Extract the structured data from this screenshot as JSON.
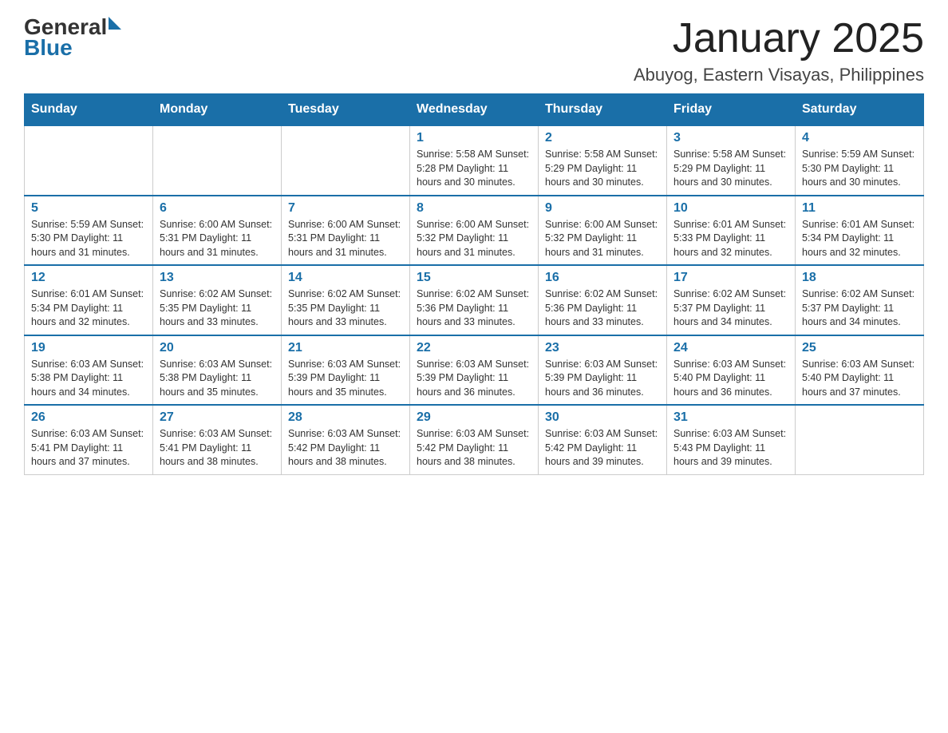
{
  "logo": {
    "text_general": "General",
    "triangle": "▶",
    "text_blue": "Blue"
  },
  "header": {
    "title": "January 2025",
    "subtitle": "Abuyog, Eastern Visayas, Philippines"
  },
  "days_of_week": [
    "Sunday",
    "Monday",
    "Tuesday",
    "Wednesday",
    "Thursday",
    "Friday",
    "Saturday"
  ],
  "weeks": [
    [
      {
        "day": "",
        "info": ""
      },
      {
        "day": "",
        "info": ""
      },
      {
        "day": "",
        "info": ""
      },
      {
        "day": "1",
        "info": "Sunrise: 5:58 AM\nSunset: 5:28 PM\nDaylight: 11 hours and 30 minutes."
      },
      {
        "day": "2",
        "info": "Sunrise: 5:58 AM\nSunset: 5:29 PM\nDaylight: 11 hours and 30 minutes."
      },
      {
        "day": "3",
        "info": "Sunrise: 5:58 AM\nSunset: 5:29 PM\nDaylight: 11 hours and 30 minutes."
      },
      {
        "day": "4",
        "info": "Sunrise: 5:59 AM\nSunset: 5:30 PM\nDaylight: 11 hours and 30 minutes."
      }
    ],
    [
      {
        "day": "5",
        "info": "Sunrise: 5:59 AM\nSunset: 5:30 PM\nDaylight: 11 hours and 31 minutes."
      },
      {
        "day": "6",
        "info": "Sunrise: 6:00 AM\nSunset: 5:31 PM\nDaylight: 11 hours and 31 minutes."
      },
      {
        "day": "7",
        "info": "Sunrise: 6:00 AM\nSunset: 5:31 PM\nDaylight: 11 hours and 31 minutes."
      },
      {
        "day": "8",
        "info": "Sunrise: 6:00 AM\nSunset: 5:32 PM\nDaylight: 11 hours and 31 minutes."
      },
      {
        "day": "9",
        "info": "Sunrise: 6:00 AM\nSunset: 5:32 PM\nDaylight: 11 hours and 31 minutes."
      },
      {
        "day": "10",
        "info": "Sunrise: 6:01 AM\nSunset: 5:33 PM\nDaylight: 11 hours and 32 minutes."
      },
      {
        "day": "11",
        "info": "Sunrise: 6:01 AM\nSunset: 5:34 PM\nDaylight: 11 hours and 32 minutes."
      }
    ],
    [
      {
        "day": "12",
        "info": "Sunrise: 6:01 AM\nSunset: 5:34 PM\nDaylight: 11 hours and 32 minutes."
      },
      {
        "day": "13",
        "info": "Sunrise: 6:02 AM\nSunset: 5:35 PM\nDaylight: 11 hours and 33 minutes."
      },
      {
        "day": "14",
        "info": "Sunrise: 6:02 AM\nSunset: 5:35 PM\nDaylight: 11 hours and 33 minutes."
      },
      {
        "day": "15",
        "info": "Sunrise: 6:02 AM\nSunset: 5:36 PM\nDaylight: 11 hours and 33 minutes."
      },
      {
        "day": "16",
        "info": "Sunrise: 6:02 AM\nSunset: 5:36 PM\nDaylight: 11 hours and 33 minutes."
      },
      {
        "day": "17",
        "info": "Sunrise: 6:02 AM\nSunset: 5:37 PM\nDaylight: 11 hours and 34 minutes."
      },
      {
        "day": "18",
        "info": "Sunrise: 6:02 AM\nSunset: 5:37 PM\nDaylight: 11 hours and 34 minutes."
      }
    ],
    [
      {
        "day": "19",
        "info": "Sunrise: 6:03 AM\nSunset: 5:38 PM\nDaylight: 11 hours and 34 minutes."
      },
      {
        "day": "20",
        "info": "Sunrise: 6:03 AM\nSunset: 5:38 PM\nDaylight: 11 hours and 35 minutes."
      },
      {
        "day": "21",
        "info": "Sunrise: 6:03 AM\nSunset: 5:39 PM\nDaylight: 11 hours and 35 minutes."
      },
      {
        "day": "22",
        "info": "Sunrise: 6:03 AM\nSunset: 5:39 PM\nDaylight: 11 hours and 36 minutes."
      },
      {
        "day": "23",
        "info": "Sunrise: 6:03 AM\nSunset: 5:39 PM\nDaylight: 11 hours and 36 minutes."
      },
      {
        "day": "24",
        "info": "Sunrise: 6:03 AM\nSunset: 5:40 PM\nDaylight: 11 hours and 36 minutes."
      },
      {
        "day": "25",
        "info": "Sunrise: 6:03 AM\nSunset: 5:40 PM\nDaylight: 11 hours and 37 minutes."
      }
    ],
    [
      {
        "day": "26",
        "info": "Sunrise: 6:03 AM\nSunset: 5:41 PM\nDaylight: 11 hours and 37 minutes."
      },
      {
        "day": "27",
        "info": "Sunrise: 6:03 AM\nSunset: 5:41 PM\nDaylight: 11 hours and 38 minutes."
      },
      {
        "day": "28",
        "info": "Sunrise: 6:03 AM\nSunset: 5:42 PM\nDaylight: 11 hours and 38 minutes."
      },
      {
        "day": "29",
        "info": "Sunrise: 6:03 AM\nSunset: 5:42 PM\nDaylight: 11 hours and 38 minutes."
      },
      {
        "day": "30",
        "info": "Sunrise: 6:03 AM\nSunset: 5:42 PM\nDaylight: 11 hours and 39 minutes."
      },
      {
        "day": "31",
        "info": "Sunrise: 6:03 AM\nSunset: 5:43 PM\nDaylight: 11 hours and 39 minutes."
      },
      {
        "day": "",
        "info": ""
      }
    ]
  ]
}
